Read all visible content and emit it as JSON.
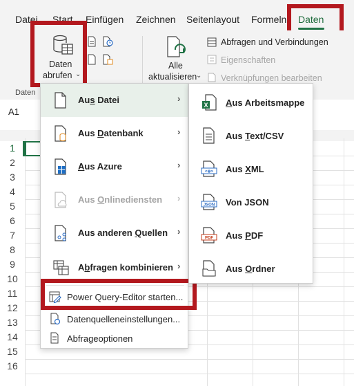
{
  "ribbon": {
    "tabs": [
      "Datei",
      "Start",
      "Einfügen",
      "Zeichnen",
      "Seitenlayout",
      "Formeln",
      "Daten"
    ],
    "active_tab": "Daten",
    "get_data": {
      "line1": "Daten",
      "line2": "abrufen"
    },
    "refresh_all": {
      "line1": "Alle",
      "line2": "aktualisieren"
    },
    "queries_connections": "Abfragen und Verbindungen",
    "properties": "Eigenschaften",
    "edit_links": "Verknüpfungen bearbeiten",
    "group_label": "Daten",
    "accent_color": "#217346",
    "highlight_color": "#b3181e"
  },
  "namebox": "A1",
  "rows": [
    "1",
    "2",
    "3",
    "4",
    "5",
    "6",
    "7",
    "8",
    "9",
    "10",
    "11",
    "12",
    "13",
    "14",
    "15",
    "16"
  ],
  "menu": {
    "items": [
      {
        "label": "Aus Datei",
        "key": "s",
        "icon": "file-icon",
        "submenu": true,
        "hover": true
      },
      {
        "label": "Aus Datenbank",
        "key": "D",
        "icon": "database-icon",
        "submenu": true
      },
      {
        "label": "Aus Azure",
        "key": "A",
        "icon": "azure-icon",
        "submenu": true
      },
      {
        "label": "Aus Onlinediensten",
        "key": "O",
        "icon": "cloud-file-icon",
        "submenu": true,
        "disabled": true
      },
      {
        "label": "Aus anderen Quellen",
        "key": "Q",
        "icon": "other-sources-icon",
        "submenu": true
      },
      {
        "label": "Abfragen kombinieren",
        "key": "b",
        "icon": "combine-queries-icon",
        "submenu": true
      }
    ],
    "power_query": "Power Query-Editor starten...",
    "data_source_settings": "Datenquelleneinstellungen...",
    "query_options": "Abfrageoptionen"
  },
  "submenu": {
    "items": [
      {
        "label": "Aus Arbeitsmappe",
        "icon": "excel-workbook-icon"
      },
      {
        "label": "Aus Text/CSV",
        "icon": "text-file-icon"
      },
      {
        "label": "Aus XML",
        "icon": "xml-file-icon"
      },
      {
        "label": "Von JSON",
        "icon": "json-file-icon"
      },
      {
        "label": "Aus PDF",
        "icon": "pdf-file-icon"
      },
      {
        "label": "Aus Ordner",
        "icon": "folder-icon"
      }
    ]
  }
}
